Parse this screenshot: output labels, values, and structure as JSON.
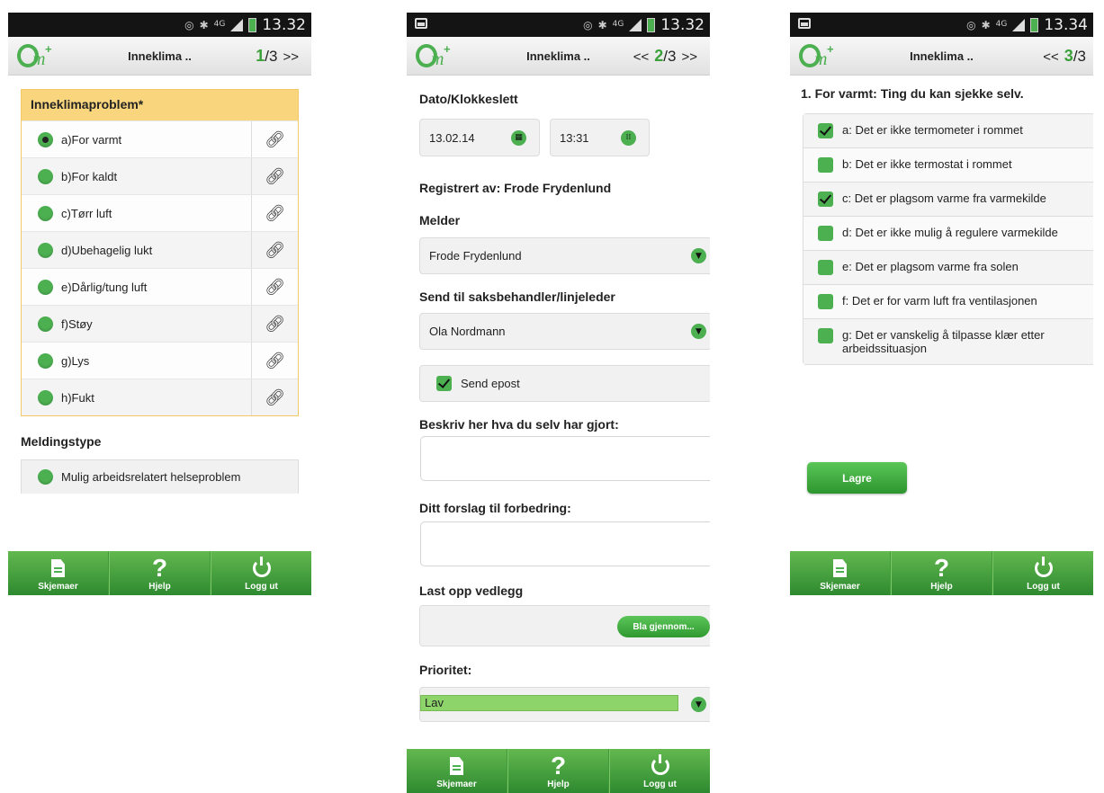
{
  "phone1": {
    "status": {
      "time": "13.32",
      "network": "4G"
    },
    "header": {
      "title": "Inneklima ..",
      "page_current": "1",
      "page_total": "/3",
      "next": ">>"
    },
    "group_title": "Inneklimaproblem*",
    "options": [
      {
        "label": "a)For varmt",
        "selected": true
      },
      {
        "label": "b)For kaldt",
        "selected": false
      },
      {
        "label": "c)Tørr luft",
        "selected": false
      },
      {
        "label": "d)Ubehagelig lukt",
        "selected": false
      },
      {
        "label": "e)Dårlig/tung luft",
        "selected": false
      },
      {
        "label": "f)Støy",
        "selected": false
      },
      {
        "label": "g)Lys",
        "selected": false
      },
      {
        "label": "h)Fukt",
        "selected": false
      }
    ],
    "message_type_label": "Meldingstype",
    "message_type_option": "Mulig arbeidsrelatert helseproblem"
  },
  "phone2": {
    "status": {
      "time": "13.32",
      "network": "4G"
    },
    "header": {
      "title": "Inneklima ..",
      "prev": "<<",
      "page_current": "2",
      "page_total": "/3",
      "next": ">>"
    },
    "datetime_label": "Dato/Klokkeslett",
    "date_value": "13.02.14",
    "time_value": "13:31",
    "registered_by": "Registrert av: Frode Frydenlund",
    "reporter_label": "Melder",
    "reporter_value": "Frode Frydenlund",
    "send_to_label": "Send til saksbehandler/linjeleder",
    "send_to_value": "Ola Nordmann",
    "send_email_label": "Send epost",
    "send_email_checked": true,
    "describe_label": "Beskriv her hva du selv har gjort:",
    "suggestion_label": "Ditt forslag til forbedring:",
    "upload_label": "Last opp vedlegg",
    "browse_button": "Bla gjennom...",
    "priority_label": "Prioritet:",
    "priority_value": "Lav"
  },
  "phone3": {
    "status": {
      "time": "13.34",
      "network": "4G"
    },
    "header": {
      "title": "Inneklima ..",
      "prev": "<<",
      "page_current": "3",
      "page_total": "/3"
    },
    "section_title": "1. For varmt: Ting du kan sjekke selv.",
    "checks": [
      {
        "label": "a: Det er ikke termometer i rommet",
        "checked": true
      },
      {
        "label": "b: Det er ikke termostat i rommet",
        "checked": false
      },
      {
        "label": "c: Det er plagsom varme fra varmekilde",
        "checked": true
      },
      {
        "label": "d: Det er ikke mulig å regulere varmekilde",
        "checked": false
      },
      {
        "label": "e: Det er plagsom varme fra solen",
        "checked": false
      },
      {
        "label": "f: Det er for varm luft fra ventilasjonen",
        "checked": false
      },
      {
        "label": "g: Det er vanskelig å tilpasse klær etter arbeidssituasjon",
        "checked": false
      }
    ],
    "save_button": "Lagre"
  },
  "footer": {
    "forms": "Skjemaer",
    "help": "Hjelp",
    "logout": "Logg ut"
  },
  "colors": {
    "green": "#4caf50",
    "header_yellow": "#f9d67e",
    "footer_green": "#3f9f3a"
  }
}
